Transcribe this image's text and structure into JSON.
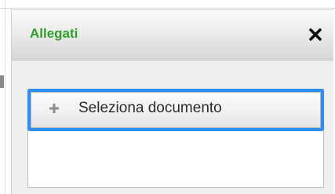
{
  "dialog": {
    "title": "Allegati",
    "title_color": "#2f9e2a",
    "close_icon": "close-icon"
  },
  "upload": {
    "select_label": "Seleziona documento",
    "select_icon": "plus-icon",
    "focus_color": "#2b8ef3"
  }
}
